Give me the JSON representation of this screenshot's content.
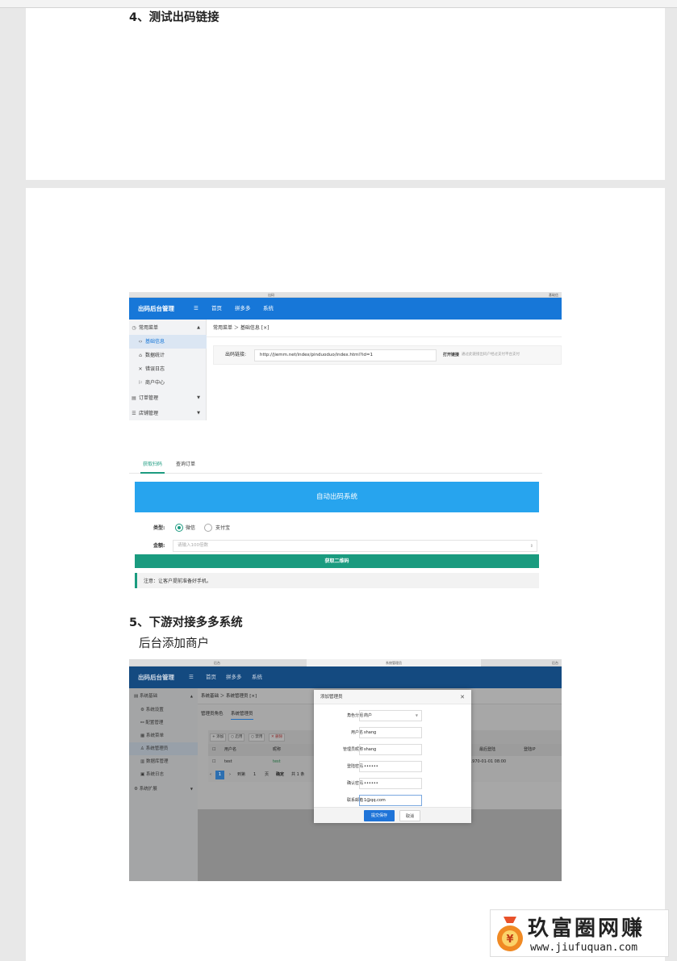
{
  "sections": {
    "s4_title": "4、测试出码链接",
    "s5_title": "5、下游对接多多系统",
    "s5_subtitle": "后台添加商户"
  },
  "shot1": {
    "chrome_tab_left": "出码",
    "chrome_tab_right": "基础信",
    "brand": "出码后台管理",
    "menu_icon": "menu-fold-icon",
    "nav": [
      "首页",
      "拼多多",
      "系统"
    ],
    "sidebar": {
      "group_common": "常用菜单",
      "items": [
        "基础信息",
        "数据统计",
        "错误日志",
        "商户中心"
      ],
      "group_order": "订单管理",
      "group_cut": "店铺管理"
    },
    "breadcrumb": "常用菜单 ＞ 基础信息 [×]",
    "form": {
      "label": "出码链接:",
      "value": "http://jiemm.net/index/pinduoduo/index.html?id=1",
      "open_btn": "打开链接",
      "hint": "通过此链接出码户经过支付平台支付"
    }
  },
  "shot2": {
    "tabs": [
      "获取扫码",
      "查询订单"
    ],
    "banner": "自动出码系统",
    "type_label": "类型:",
    "type_options": [
      "微信",
      "支付宝"
    ],
    "type_selected": "微信",
    "amount_label": "金额:",
    "amount_placeholder": "请输入100倍数",
    "submit": "获取二维码",
    "note": "注意：让客户提前准备好手机。"
  },
  "shot3": {
    "chrome_tabs": [
      "后台",
      "系统管理员",
      "后台"
    ],
    "brand": "出码后台管理",
    "nav": [
      "首页",
      "拼多多",
      "系统"
    ],
    "sidebar": {
      "group": "系统基础",
      "items": [
        "系统设置",
        "配置管理",
        "系统菜单",
        "系统管理员",
        "数据库管理",
        "系统日志"
      ],
      "group2": "系统扩展"
    },
    "breadcrumb": "系统基础 ＞ 系统管理员 [×]",
    "tabs": [
      "管理员角色",
      "系统管理员"
    ],
    "toolbar": [
      "添加",
      "启用",
      "禁用",
      "删除"
    ],
    "table": {
      "headers": [
        "用户名",
        "昵称",
        "最后登陆",
        "登陆IP"
      ],
      "row": [
        "test",
        "test",
        "1970-01-01 08:00",
        ""
      ]
    },
    "pager": {
      "current": "1",
      "goto": "到第",
      "page": "1",
      "unit": "页",
      "confirm": "确定",
      "total": "共 1 条"
    },
    "modal": {
      "title": "添加管理员",
      "fields": [
        {
          "label": "角色分组",
          "value": "商户"
        },
        {
          "label": "用户名",
          "value": "shang"
        },
        {
          "label": "管理员昵称",
          "value": "shang"
        },
        {
          "label": "登陆密码",
          "value": "••••••"
        },
        {
          "label": "确认密码",
          "value": "••••••"
        },
        {
          "label": "联系邮箱",
          "value": "1@qq.com"
        }
      ],
      "save": "提交保存",
      "cancel": "取消"
    }
  },
  "watermark": {
    "cn": "玖富圈网赚",
    "url": "www.jiufuquan.com"
  }
}
